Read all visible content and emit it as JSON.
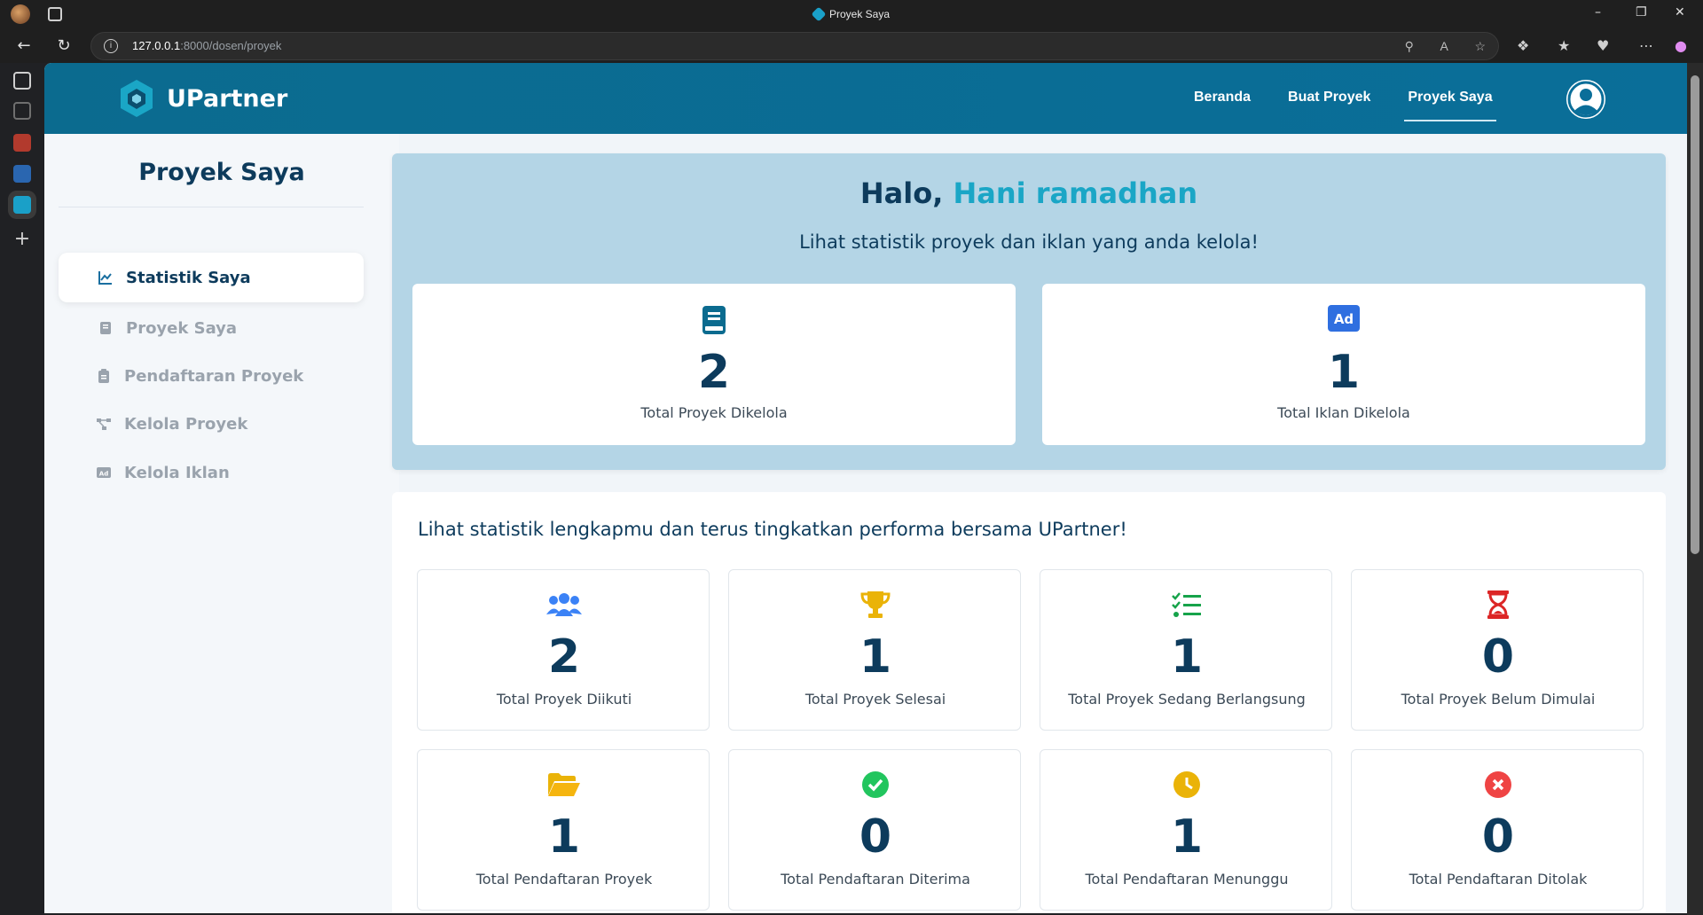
{
  "browser": {
    "tab_title": "Proyek Saya",
    "url_host": "127.0.0.1",
    "url_path": ":8000/dosen/proyek"
  },
  "app": {
    "brand": "UPartner",
    "nav": [
      "Beranda",
      "Buat Proyek",
      "Proyek Saya"
    ],
    "active_nav": "Proyek Saya",
    "colors": {
      "primary": "#0b6b8f",
      "accent": "#1aa6c6",
      "text": "#0d3b5c"
    }
  },
  "sidebar": {
    "title": "Proyek Saya",
    "items": [
      {
        "label": "Statistik Saya",
        "icon": "chart-line-icon",
        "active": true
      },
      {
        "label": "Proyek Saya",
        "icon": "book-icon",
        "active": false
      },
      {
        "label": "Pendaftaran Proyek",
        "icon": "clipboard-icon",
        "active": false
      },
      {
        "label": "Kelola Proyek",
        "icon": "project-diagram-icon",
        "active": false
      },
      {
        "label": "Kelola Iklan",
        "icon": "ad-icon",
        "active": false
      }
    ]
  },
  "hero": {
    "greeting": "Halo,",
    "user_name": "Hani ramadhan",
    "subtitle": "Lihat statistik proyek dan iklan yang anda kelola!",
    "cards": [
      {
        "icon": "book-icon",
        "value": "2",
        "label": "Total Proyek Dikelola"
      },
      {
        "icon": "ad-icon",
        "icon_text": "Ad",
        "value": "1",
        "label": "Total Iklan Dikelola"
      }
    ]
  },
  "stats": {
    "heading": "Lihat statistik lengkapmu dan terus tingkatkan performa bersama UPartner!",
    "cards": [
      {
        "icon": "users-icon",
        "value": "2",
        "label": "Total Proyek Diikuti"
      },
      {
        "icon": "trophy-icon",
        "value": "1",
        "label": "Total Proyek Selesai"
      },
      {
        "icon": "list-check-icon",
        "value": "1",
        "label": "Total Proyek Sedang Berlangsung"
      },
      {
        "icon": "hourglass-icon",
        "value": "0",
        "label": "Total Proyek Belum Dimulai"
      },
      {
        "icon": "folder-open-icon",
        "value": "1",
        "label": "Total Pendaftaran Proyek"
      },
      {
        "icon": "check-circle-icon",
        "value": "0",
        "label": "Total Pendaftaran Diterima"
      },
      {
        "icon": "clock-icon",
        "value": "1",
        "label": "Total Pendaftaran Menunggu"
      },
      {
        "icon": "times-circle-icon",
        "value": "0",
        "label": "Total Pendaftaran Ditolak"
      }
    ]
  }
}
